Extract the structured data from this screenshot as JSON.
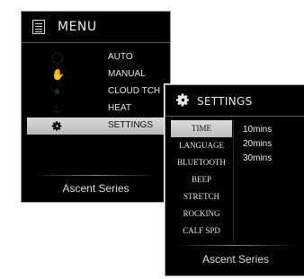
{
  "menu": {
    "title": "MENU",
    "icon": "menu-icon",
    "items": [
      {
        "label": "AUTO",
        "icon": "circle-icon",
        "selected": false
      },
      {
        "label": "MANUAL",
        "icon": "hand-icon",
        "selected": false
      },
      {
        "label": "CLOUD TCH",
        "icon": "star-icon",
        "selected": false
      },
      {
        "label": "HEAT",
        "icon": "flame-icon",
        "selected": false
      },
      {
        "label": "SETTINGS",
        "icon": "gear-icon",
        "selected": true
      }
    ],
    "footer": "Ascent Series"
  },
  "settings": {
    "title": "SETTINGS",
    "icon": "gear-icon",
    "items": [
      {
        "label": "TIME",
        "selected": true
      },
      {
        "label": "LANGUAGE",
        "selected": false
      },
      {
        "label": "BLUETOOTH",
        "selected": false
      },
      {
        "label": "BEEP",
        "selected": false
      },
      {
        "label": "STRETCH",
        "selected": false
      },
      {
        "label": "ROCKING",
        "selected": false
      },
      {
        "label": "CALF SPD",
        "selected": false
      }
    ],
    "options": [
      "10mins",
      "20mins",
      "30mins"
    ],
    "footer": "Ascent Series"
  },
  "colors": {
    "panel_bg": "#000000",
    "highlight": "#c8c8c8",
    "text": "#e6e6e6"
  }
}
